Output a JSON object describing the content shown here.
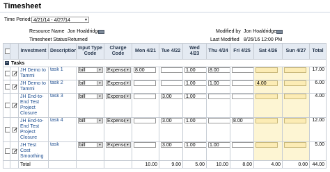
{
  "page": {
    "title": "Timesheet",
    "time_period_label": "Time Period:",
    "time_period_value": "4/21/14 - 4/27/14",
    "resource_name_label": "Resource Name",
    "resource_name_value": "Jon Hoaldridge",
    "modified_by_label": "Modified by",
    "modified_by_value": "Jon Hoaldridge",
    "status_label": "Timesheet Status",
    "status_value": "Returned",
    "last_modified_label": "Last Modified",
    "last_modified_value": "8/26/16 12:00 PM"
  },
  "columns": {
    "investment": "Investment",
    "description": "Description",
    "input_type": "Input Type Code",
    "charge": "Charge Code",
    "mon": "Mon 4/21",
    "tue": "Tue 4/22",
    "wed": "Wed 4/23",
    "thu": "Thu 4/24",
    "fri": "Fri 4/25",
    "sat": "Sat 4/26",
    "sun": "Sun 4/27",
    "total": "Total"
  },
  "section": {
    "label": "Tasks"
  },
  "rows": [
    {
      "investment": "JH Demo to Tammi",
      "task": "task 1",
      "input": "bill",
      "charge": "Expense",
      "mon": "8.00",
      "tue": "",
      "wed": "1.00",
      "thu": "8.00",
      "fri": "",
      "sat": "",
      "sun": "",
      "total": "17.00"
    },
    {
      "investment": "JH Demo to Tammi",
      "task": "task 2",
      "input": "bill",
      "charge": "Expense",
      "mon": "",
      "tue": "",
      "wed": "1.00",
      "thu": "1.00",
      "fri": "",
      "sat": "4.00",
      "sun": "",
      "total": "6.00"
    },
    {
      "investment": "JH End-to-End Test Project Closure",
      "task": "task 3",
      "input": "bill",
      "charge": "Expense",
      "mon": "",
      "tue": "3.00",
      "wed": "1.00",
      "thu": "",
      "fri": "",
      "sat": "",
      "sun": "",
      "total": "4.00"
    },
    {
      "investment": "JH End-to-End Test Project Closure",
      "task": "task 4",
      "input": "bill",
      "charge": "Expense",
      "mon": "",
      "tue": "3.00",
      "wed": "1.00",
      "thu": "",
      "fri": "8.00",
      "sat": "",
      "sun": "",
      "total": "12.00"
    },
    {
      "investment": "JH Test Cost Smoothing",
      "task": "task",
      "input": "bill",
      "charge": "Expense",
      "mon": "",
      "tue": "3.00",
      "wed": "1.00",
      "thu": "1.00",
      "fri": "",
      "sat": "",
      "sun": "",
      "total": "5.00"
    }
  ],
  "totals": {
    "label": "Total",
    "mon": "10.00",
    "tue": "9.00",
    "wed": "5.00",
    "thu": "10.00",
    "fri": "8.00",
    "sat": "4.00",
    "sun": "0.00",
    "total": "44.00"
  }
}
